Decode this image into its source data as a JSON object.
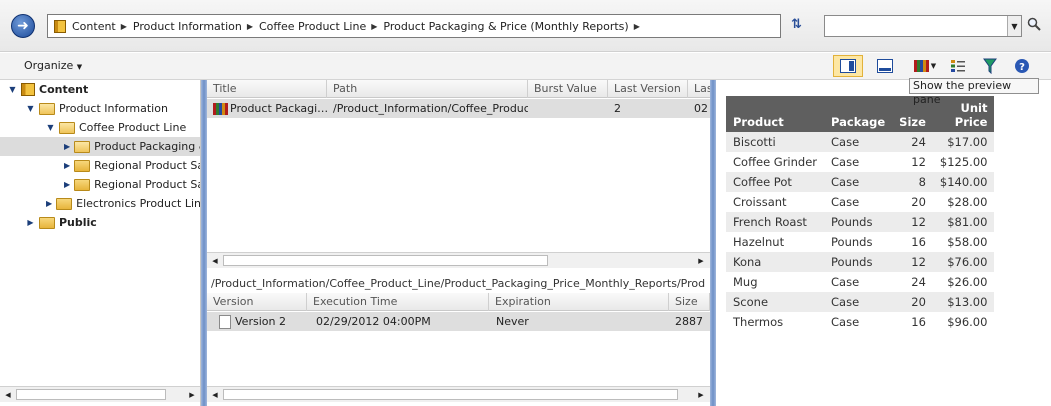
{
  "address": {
    "crumbs": [
      "Content",
      "Product Information",
      "Coffee Product Line",
      "Product Packaging & Price (Monthly Reports)"
    ],
    "search_value": ""
  },
  "toolbar": {
    "organize_label": "Organize",
    "tooltip": "Show the preview pane"
  },
  "tree": {
    "content": "Content",
    "product_information": "Product Information",
    "coffee_product_line": "Coffee Product Line",
    "product_packaging": "Product Packaging &",
    "regional_sales_1": "Regional Product Sal",
    "regional_sales_2": "Regional Product Sal",
    "electronics": "Electronics Product Line",
    "public": "Public"
  },
  "reports_grid": {
    "headers": [
      "Title",
      "Path",
      "Burst Value",
      "Last Version",
      "Las"
    ],
    "row": {
      "title": "Product Packagi…",
      "path": "/Product_Information/Coffee_Produc…",
      "burst_value": "",
      "last_version": "2",
      "last": "02"
    }
  },
  "version_grid": {
    "path_label": "/Product_Information/Coffee_Product_Line/Product_Packaging_Price_Monthly_Reports/Product Pa",
    "headers": [
      "Version",
      "Execution Time",
      "Expiration",
      "Size"
    ],
    "row": {
      "version": "Version 2",
      "execution_time": "02/29/2012 04:00PM",
      "expiration": "Never",
      "size": "2887"
    }
  },
  "preview": {
    "headers": {
      "product": "Product",
      "package": "Package",
      "size": "Size",
      "unit": "Unit",
      "price": "Price"
    },
    "rows": [
      {
        "product": "Biscotti",
        "package": "Case",
        "size": "24",
        "price": "$17.00"
      },
      {
        "product": "Coffee Grinder",
        "package": "Case",
        "size": "12",
        "price": "$125.00"
      },
      {
        "product": "Coffee Pot",
        "package": "Case",
        "size": "8",
        "price": "$140.00"
      },
      {
        "product": "Croissant",
        "package": "Case",
        "size": "20",
        "price": "$28.00"
      },
      {
        "product": "French Roast",
        "package": "Pounds",
        "size": "12",
        "price": "$81.00"
      },
      {
        "product": "Hazelnut",
        "package": "Pounds",
        "size": "16",
        "price": "$58.00"
      },
      {
        "product": "Kona",
        "package": "Pounds",
        "size": "12",
        "price": "$76.00"
      },
      {
        "product": "Mug",
        "package": "Case",
        "size": "24",
        "price": "$26.00"
      },
      {
        "product": "Scone",
        "package": "Case",
        "size": "20",
        "price": "$13.00"
      },
      {
        "product": "Thermos",
        "package": "Case",
        "size": "16",
        "price": "$96.00"
      }
    ]
  }
}
